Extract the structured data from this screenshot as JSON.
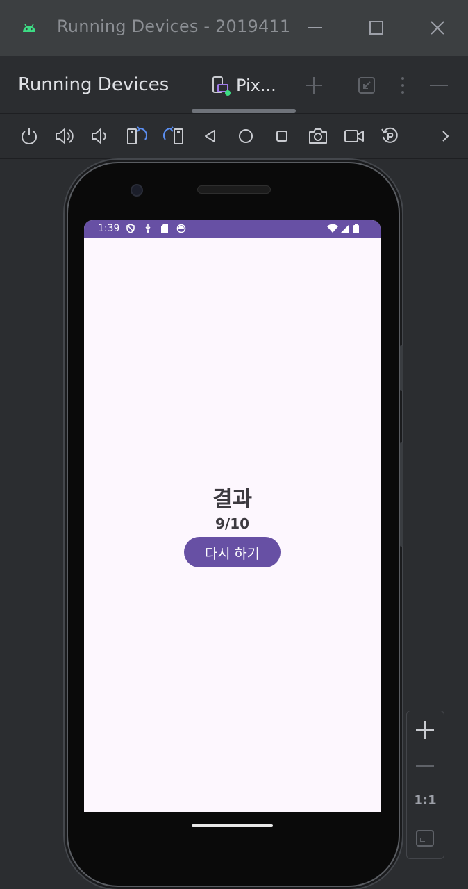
{
  "window": {
    "title": "Running Devices - 2019411",
    "icon": "android-icon",
    "controls": [
      "minimize-icon",
      "maximize-icon",
      "close-icon"
    ]
  },
  "tool_header": {
    "title": "Running Devices",
    "device_tab_label": "Pix...",
    "actions": [
      "add-icon",
      "restore-icon",
      "more-vertical-icon",
      "hide-icon"
    ]
  },
  "device_toolbar": {
    "buttons": [
      "power-icon",
      "volume-up-icon",
      "volume-down-icon",
      "rotate-left-icon",
      "rotate-right-icon",
      "back-icon",
      "home-icon",
      "overview-icon",
      "screenshot-icon",
      "screen-record-icon",
      "reset-icon",
      "chevron-right-icon"
    ]
  },
  "phone": {
    "status_bar": {
      "time": "1:39",
      "left_icons": [
        "shield-icon",
        "download-icon",
        "sd-card-icon",
        "app-icon"
      ],
      "right_icons": [
        "wifi-icon",
        "signal-icon",
        "battery-icon"
      ]
    },
    "screen": {
      "title": "결과",
      "score": "9/10",
      "retry_label": "다시 하기"
    }
  },
  "zoom": {
    "reset_label": "1:1",
    "buttons": [
      "zoom-in-icon",
      "zoom-out-icon",
      "fit-screen-icon"
    ]
  },
  "colors": {
    "accent": "#6750a4",
    "screen_bg": "#fdf7fe",
    "ide_bg": "#2b2d30",
    "android_green": "#3ddc84"
  }
}
